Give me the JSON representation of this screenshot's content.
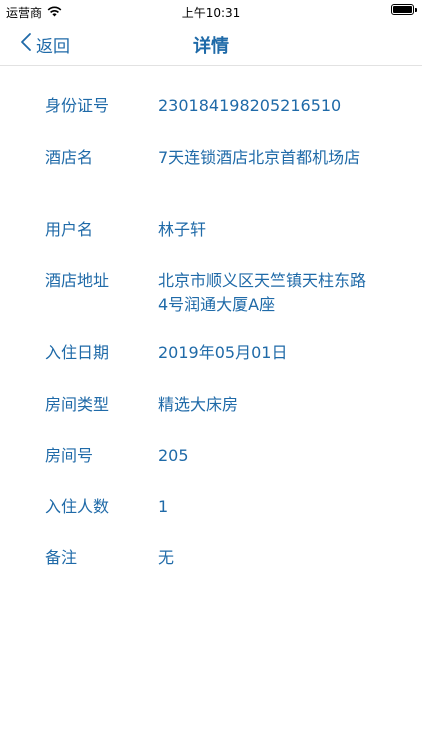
{
  "status_bar": {
    "carrier": "运营商",
    "time": "上午10:31"
  },
  "nav": {
    "back_label": "返回",
    "title": "详情"
  },
  "details": [
    {
      "label": "身份证号",
      "value": "230184198205216510"
    },
    {
      "label": "酒店名",
      "value": "7天连锁酒店北京首都机场店"
    },
    {
      "label": "用户名",
      "value": "林子轩"
    },
    {
      "label": "酒店地址",
      "value": "北京市顺义区天竺镇天柱东路4号润通大厦A座"
    },
    {
      "label": "入住日期",
      "value": "2019年05月01日"
    },
    {
      "label": "房间类型",
      "value": "精选大床房"
    },
    {
      "label": "房间号",
      "value": "205"
    },
    {
      "label": "入住人数",
      "value": "1"
    },
    {
      "label": "备注",
      "value": "无"
    }
  ]
}
